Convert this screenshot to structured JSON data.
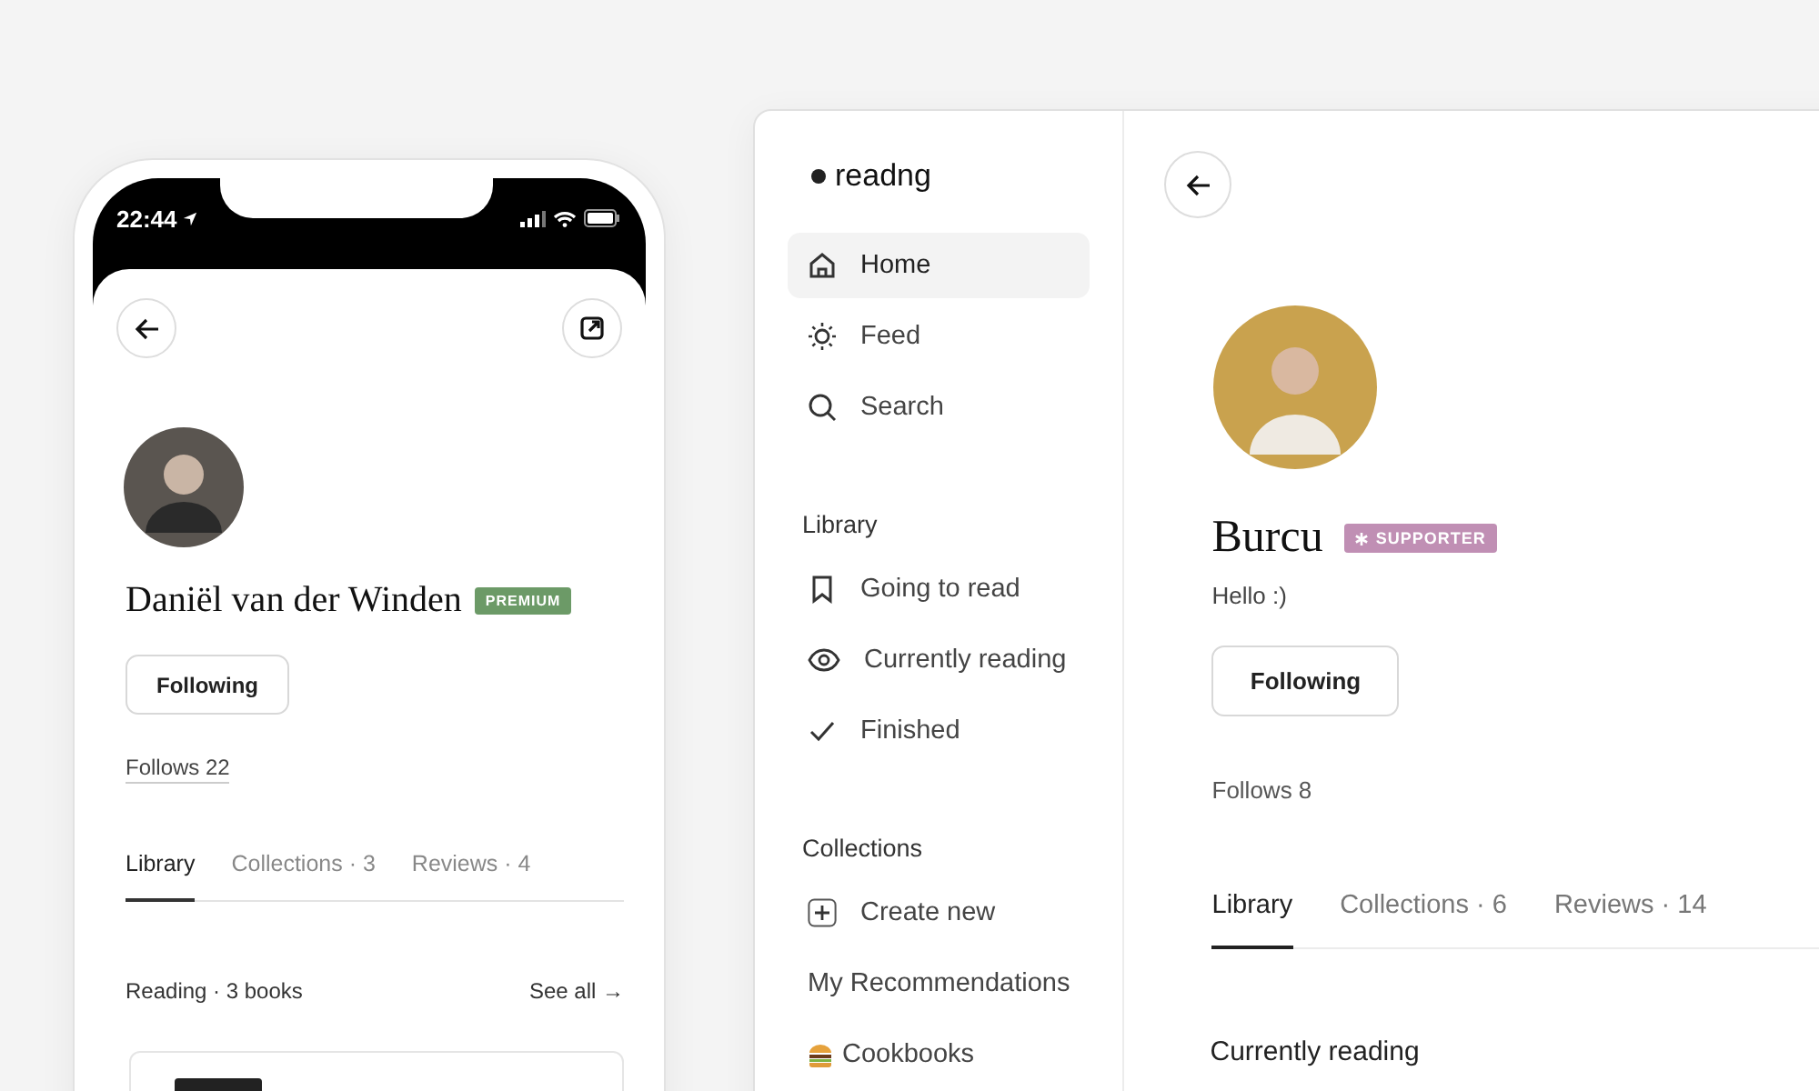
{
  "phone": {
    "status_bar": {
      "time": "22:44"
    },
    "profile": {
      "name": "Daniël van der Winden",
      "badge": {
        "kind": "premium",
        "label": "PREMIUM"
      },
      "follow_button": "Following",
      "follows": "Follows 22"
    },
    "tabs": [
      {
        "label": "Library",
        "selected": true
      },
      {
        "label": "Collections · 3",
        "selected": false
      },
      {
        "label": "Reviews · 4",
        "selected": false
      }
    ],
    "section": {
      "title": "Reading · 3 books",
      "link": "See all →"
    }
  },
  "desktop": {
    "logo": "readng",
    "nav": [
      {
        "label": "Home",
        "kind": "home",
        "selected": true
      },
      {
        "label": "Feed",
        "kind": "feed",
        "selected": false
      },
      {
        "label": "Search",
        "kind": "search",
        "selected": false
      }
    ],
    "sections": [
      {
        "title": "Library",
        "items": [
          {
            "label": "Going to read",
            "kind": "saved"
          },
          {
            "label": "Currently reading",
            "kind": "reading"
          },
          {
            "label": "Finished",
            "kind": "finished"
          }
        ]
      },
      {
        "title": "Collections",
        "items": [
          {
            "label": "Create new",
            "kind": "create"
          },
          {
            "label": "My Recommendations",
            "kind": "collection"
          },
          {
            "label": "Cookbooks",
            "kind": "food"
          }
        ]
      }
    ],
    "profile": {
      "name": "Burcu",
      "badge": {
        "kind": "supporter",
        "label": "SUPPORTER"
      },
      "bio": "Hello :)",
      "follow_button": "Following",
      "follows": "Follows 8"
    },
    "tabs": [
      {
        "label": "Library",
        "selected": true
      },
      {
        "label": "Collections · 6",
        "selected": false
      },
      {
        "label": "Reviews · 14",
        "selected": false
      }
    ],
    "section_title": "Currently reading"
  }
}
